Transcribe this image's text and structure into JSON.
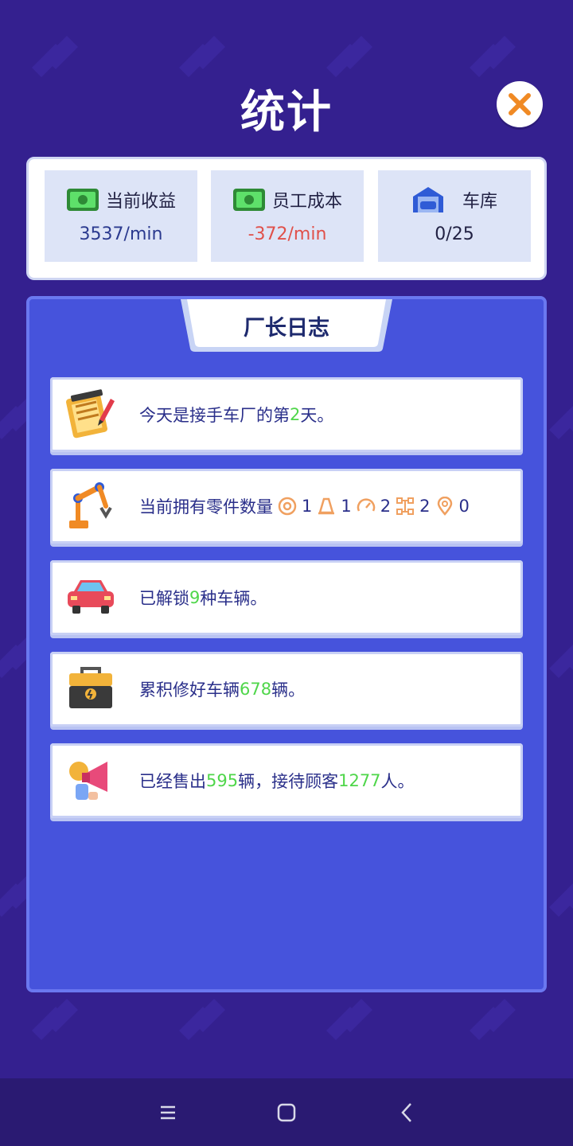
{
  "header": {
    "title": "统计",
    "close_icon": "close-icon"
  },
  "stats": [
    {
      "icon": "cash-icon",
      "label": "当前收益",
      "value": "3537/min",
      "value_color": "#2b3a8f"
    },
    {
      "icon": "cash-icon",
      "label": "员工成本",
      "value": "-372/min",
      "value_color": "#e0504a"
    },
    {
      "icon": "garage-icon",
      "label": "车库",
      "value": "0/25",
      "value_color": "#222244"
    }
  ],
  "log": {
    "title": "厂长日志",
    "row1": {
      "icon": "notepad-icon",
      "pre": "今天是接手车厂的第",
      "num": "2",
      "post": "天。"
    },
    "row2": {
      "icon": "robot-arm-icon",
      "pre": "当前拥有零件数量",
      "parts": [
        {
          "icon": "tire-icon",
          "count": "1"
        },
        {
          "icon": "cone-icon",
          "count": "1"
        },
        {
          "icon": "gauge-icon",
          "count": "2"
        },
        {
          "icon": "chassis-icon",
          "count": "2"
        },
        {
          "icon": "location-pin-icon",
          "count": "0"
        }
      ]
    },
    "row3": {
      "icon": "car-icon",
      "pre": "已解锁",
      "num": "9",
      "post": "种车辆。"
    },
    "row4": {
      "icon": "toolbox-icon",
      "pre": "累积修好车辆",
      "num": "678",
      "post": "辆。"
    },
    "row5": {
      "icon": "megaphone-icon",
      "pre": "已经售出",
      "num1": "595",
      "mid": "辆，接待顾客",
      "num2": "1277",
      "post": "人。"
    }
  },
  "nav": {
    "menu_icon": "menu-icon",
    "home_icon": "home-icon",
    "back_icon": "back-icon"
  },
  "colors": {
    "background": "#34208f",
    "panel": "#4653dc",
    "highlight": "#4fd64a",
    "accent": "#f08a24"
  }
}
